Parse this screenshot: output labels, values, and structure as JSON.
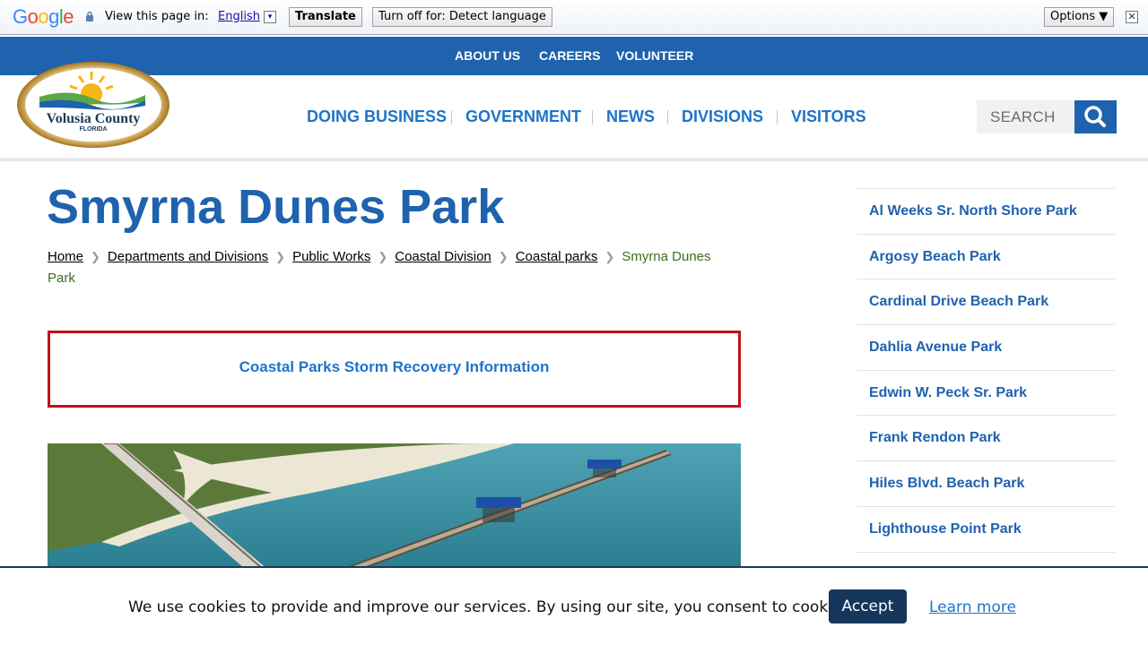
{
  "translate_bar": {
    "logo_text": "Google",
    "prompt": "View this page in:",
    "language": "English",
    "language_caret": "▾",
    "translate_button": "Translate",
    "turn_off_button": "Turn off for: Detect language",
    "options_button": "Options ▼",
    "close_label": "✕"
  },
  "top_nav": {
    "items": [
      "ABOUT US",
      "CAREERS",
      "VOLUNTEER"
    ]
  },
  "logo": {
    "name": "Volusia County",
    "subtitle": "FLORIDA"
  },
  "main_nav": {
    "items": [
      "DOING BUSINESS",
      "GOVERNMENT",
      "NEWS",
      "DIVISIONS",
      "VISITORS"
    ]
  },
  "search": {
    "placeholder": "SEARCH"
  },
  "page": {
    "title": "Smyrna Dunes Park",
    "breadcrumb": [
      "Home",
      "Departments and Divisions",
      "Public Works",
      "Coastal Division",
      "Coastal parks"
    ],
    "breadcrumb_current": "Smyrna Dunes Park",
    "alert_link": "Coastal Parks Storm Recovery Information"
  },
  "sidebar": {
    "items": [
      "Al Weeks Sr. North Shore Park",
      "Argosy Beach Park",
      "Cardinal Drive Beach Park",
      "Dahlia Avenue Park",
      "Edwin W. Peck Sr. Park",
      "Frank Rendon Park",
      "Hiles Blvd. Beach Park",
      "Lighthouse Point Park"
    ]
  },
  "cookie_bar": {
    "message": "We use cookies to provide and improve our services. By using our site, you consent to cookies.",
    "accept": "Accept",
    "learn_more": "Learn more"
  },
  "colors": {
    "brand_blue": "#1f62ae",
    "link_blue": "#1f74c9",
    "alert_red": "#c0121b",
    "cookie_navy": "#15365b"
  }
}
